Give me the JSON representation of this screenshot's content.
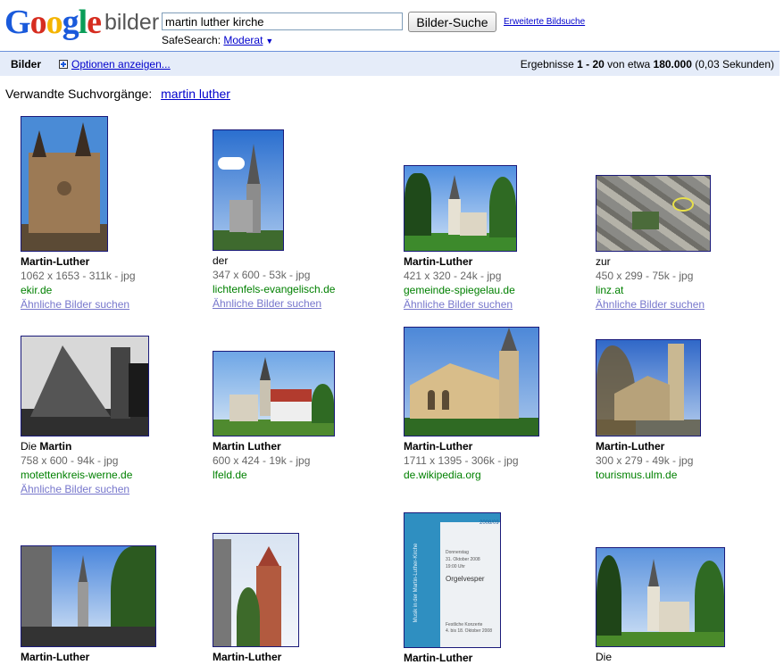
{
  "logo": {
    "google": "Google",
    "bilder": "bilder"
  },
  "search": {
    "value": "martin luther kirche",
    "button_label": "Bilder-Suche",
    "advanced_label": "Erweiterte Bildsuche"
  },
  "safesearch": {
    "label": "SafeSearch:",
    "value": "Moderat"
  },
  "bar": {
    "title": "Bilder",
    "options_label": "Optionen anzeigen...",
    "stats_prefix": "Ergebnisse",
    "range": "1 - 20",
    "stats_mid": "von etwa",
    "total": "180.000",
    "time": "(0,03 Sekunden)"
  },
  "related": {
    "label": "Verwandte Suchvorgänge:",
    "link": "martin luther"
  },
  "similar_label": "Ähnliche Bilder suchen",
  "results": [
    {
      "title_plain": "",
      "title_bold": "Martin-Luther",
      "dims": "1062 x 1653 - 311k - jpg",
      "domain": "ekir.de",
      "similar": true
    },
    {
      "title_plain": "der",
      "title_bold": "",
      "dims": "347 x 600 - 53k - jpg",
      "domain": "lichtenfels-evangelisch.de",
      "similar": true
    },
    {
      "title_plain": "",
      "title_bold": "Martin-Luther",
      "dims": "421 x 320 - 24k - jpg",
      "domain": "gemeinde-spiegelau.de",
      "similar": true
    },
    {
      "title_plain": "zur",
      "title_bold": "",
      "dims": "450 x 299 - 75k - jpg",
      "domain": "linz.at",
      "similar": true
    },
    {
      "title_plain": "Die ",
      "title_bold": "Martin",
      "dims": "758 x 600 - 94k - jpg",
      "domain": "motettenkreis-werne.de",
      "similar": true
    },
    {
      "title_plain": "",
      "title_bold": "Martin Luther",
      "dims": "600 x 424 - 19k - jpg",
      "domain": "lfeld.de",
      "similar": false
    },
    {
      "title_plain": "",
      "title_bold": "Martin-Luther",
      "dims": "1711 x 1395 - 306k - jpg",
      "domain": "de.wikipedia.org",
      "similar": false
    },
    {
      "title_plain": "",
      "title_bold": "Martin-Luther",
      "dims": "300 x 279 - 49k - jpg",
      "domain": "tourismus.ulm.de",
      "similar": false
    },
    {
      "title_plain": "",
      "title_bold": "Martin-Luther",
      "dims": "",
      "domain": "",
      "similar": false
    },
    {
      "title_plain": "",
      "title_bold": "Martin-Luther",
      "dims": "",
      "domain": "",
      "similar": false
    },
    {
      "title_plain": "",
      "title_bold": "Martin-Luther",
      "dims": "",
      "domain": "",
      "similar": false
    },
    {
      "title_plain": "Die",
      "title_bold": "",
      "dims": "",
      "domain": "",
      "similar": false
    }
  ],
  "poster_text": {
    "year": "2008/09",
    "lines": [
      "Donnerstag",
      "31. Oktober 2008",
      "19:00 Uhr",
      "Orgelvesper"
    ],
    "side": "Musik in der Martin-Luther-Kirche",
    "footer": [
      "Festliche Konzerte",
      "4. bis 18. Oktober 2008"
    ]
  }
}
